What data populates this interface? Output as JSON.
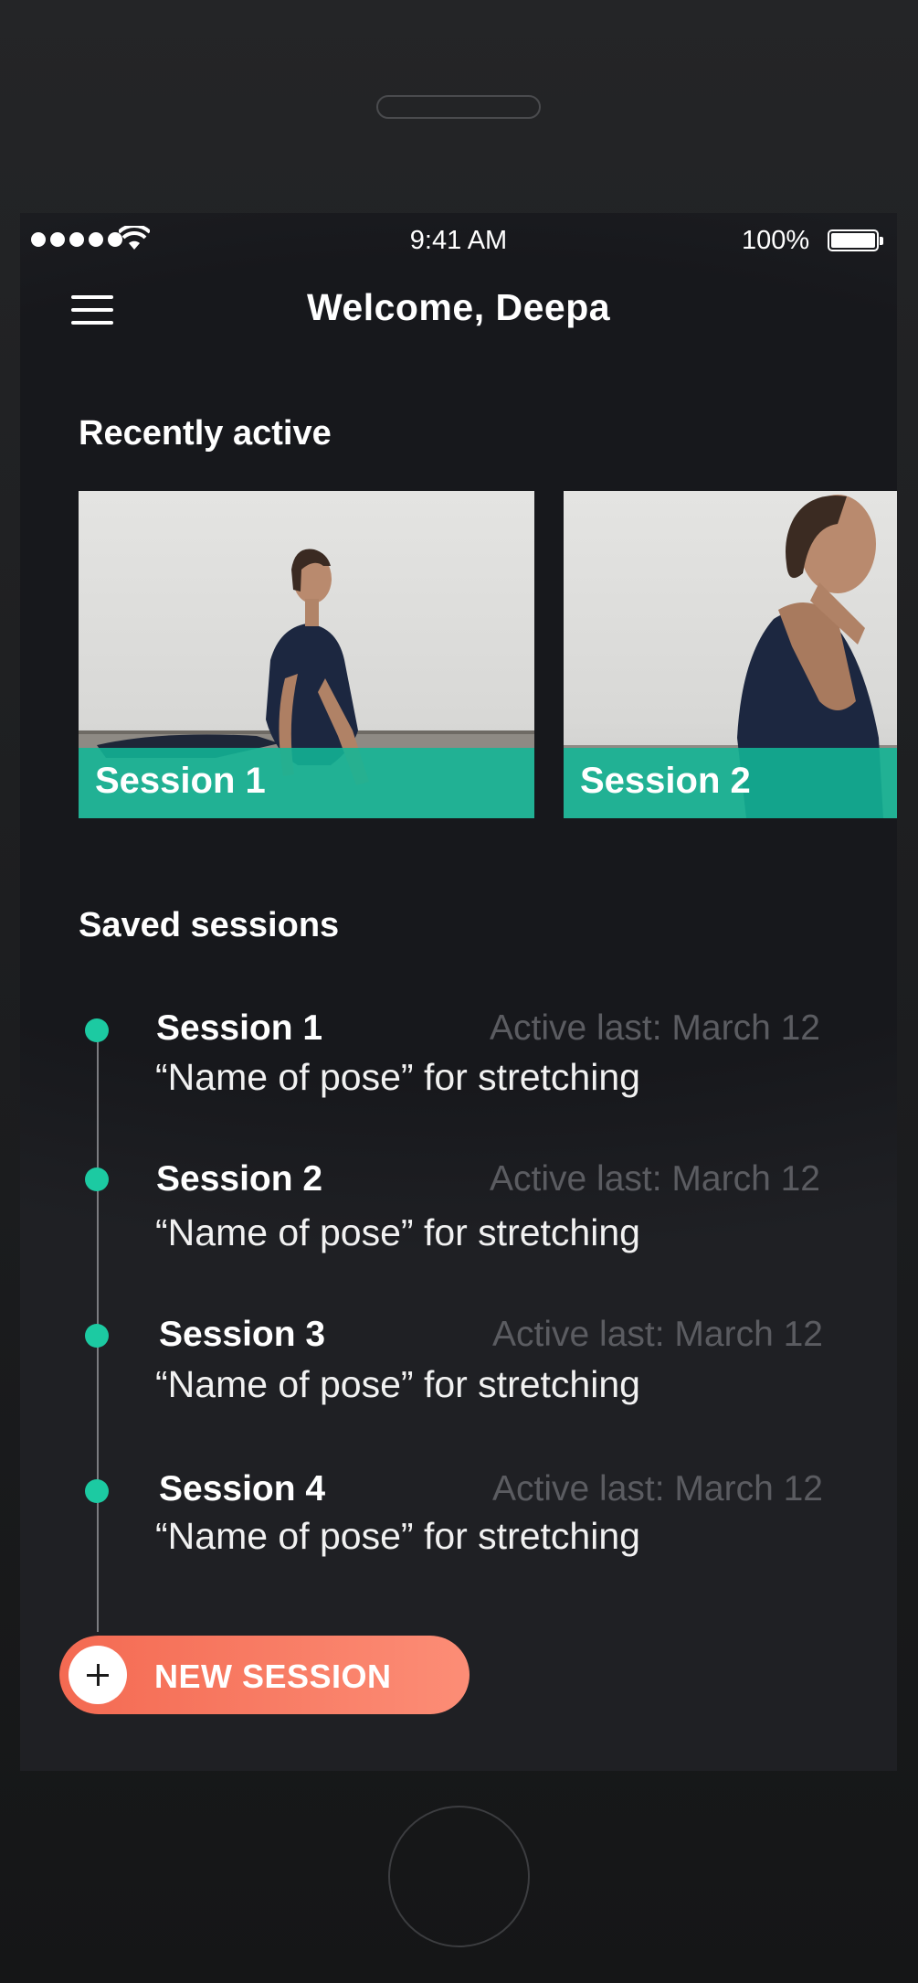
{
  "status_bar": {
    "time": "9:41 AM",
    "battery": "100%"
  },
  "header": {
    "title": "Welcome, Deepa",
    "menu_icon": "hamburger-menu-icon"
  },
  "recently_active": {
    "title": "Recently active",
    "cards": [
      {
        "label": "Session 1"
      },
      {
        "label": "Session 2"
      }
    ]
  },
  "saved_sessions": {
    "title": "Saved sessions",
    "items": [
      {
        "title": "Session 1",
        "date": "Active last: March 12",
        "subtitle": "“Name of pose” for stretching"
      },
      {
        "title": "Session 2",
        "date": "Active last: March 12",
        "subtitle": "“Name of pose” for stretching"
      },
      {
        "title": "Session 3",
        "date": "Active last: March 12",
        "subtitle": "“Name of pose” for stretching"
      },
      {
        "title": "Session 4",
        "date": "Active last: March 12",
        "subtitle": "“Name of pose” for stretching"
      }
    ]
  },
  "new_session_button": {
    "label": "NEW SESSION",
    "icon": "plus-icon"
  },
  "colors": {
    "accent": "#1ccaa2",
    "button": "#f7735c",
    "background": "#17181c"
  }
}
